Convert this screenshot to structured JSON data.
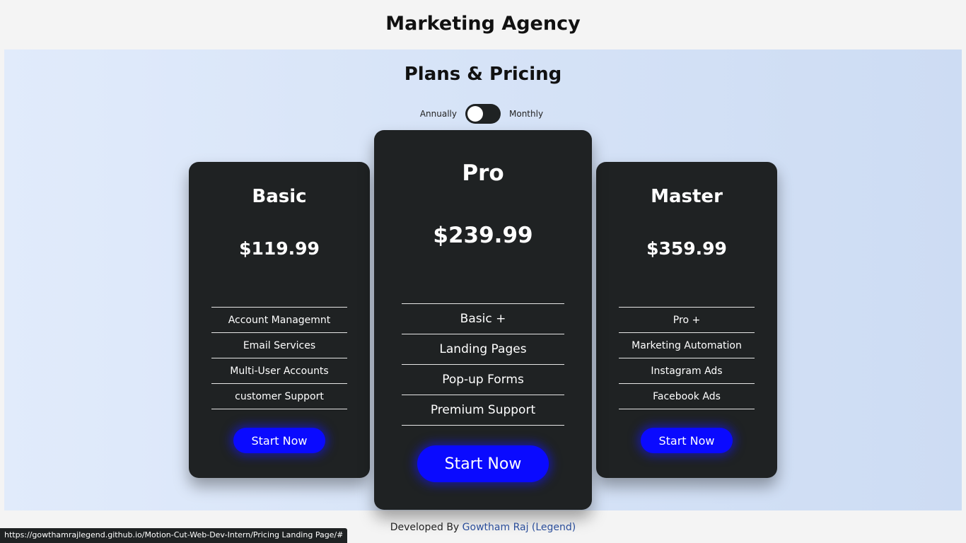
{
  "header": {
    "title": "Marketing Agency"
  },
  "section": {
    "title": "Plans & Pricing",
    "toggle": {
      "left_label": "Annually",
      "right_label": "Monthly"
    }
  },
  "plans": [
    {
      "name": "Basic",
      "price": "$119.99",
      "features": [
        "Account Managemnt",
        "Email Services",
        "Multi-User Accounts",
        "customer Support"
      ],
      "button_label": "Start Now"
    },
    {
      "name": "Pro",
      "price": "$239.99",
      "features": [
        "Basic +",
        "Landing Pages",
        "Pop-up Forms",
        "Premium Support"
      ],
      "button_label": "Start Now"
    },
    {
      "name": "Master",
      "price": "$359.99",
      "features": [
        "Pro +",
        "Marketing Automation",
        "Instagram Ads",
        "Facebook Ads"
      ],
      "button_label": "Start Now"
    }
  ],
  "footer": {
    "prefix": "Developed By",
    "author_link": "Gowtham Raj (Legend)"
  },
  "status_bar": {
    "url": "https://gowthamrajlegend.github.io/Motion-Cut-Web-Dev-Intern/Pricing Landing Page/#"
  },
  "colors": {
    "card_bg": "#1f2223",
    "button_bg": "#0a0aff",
    "section_bg": "#d6e3f7"
  }
}
